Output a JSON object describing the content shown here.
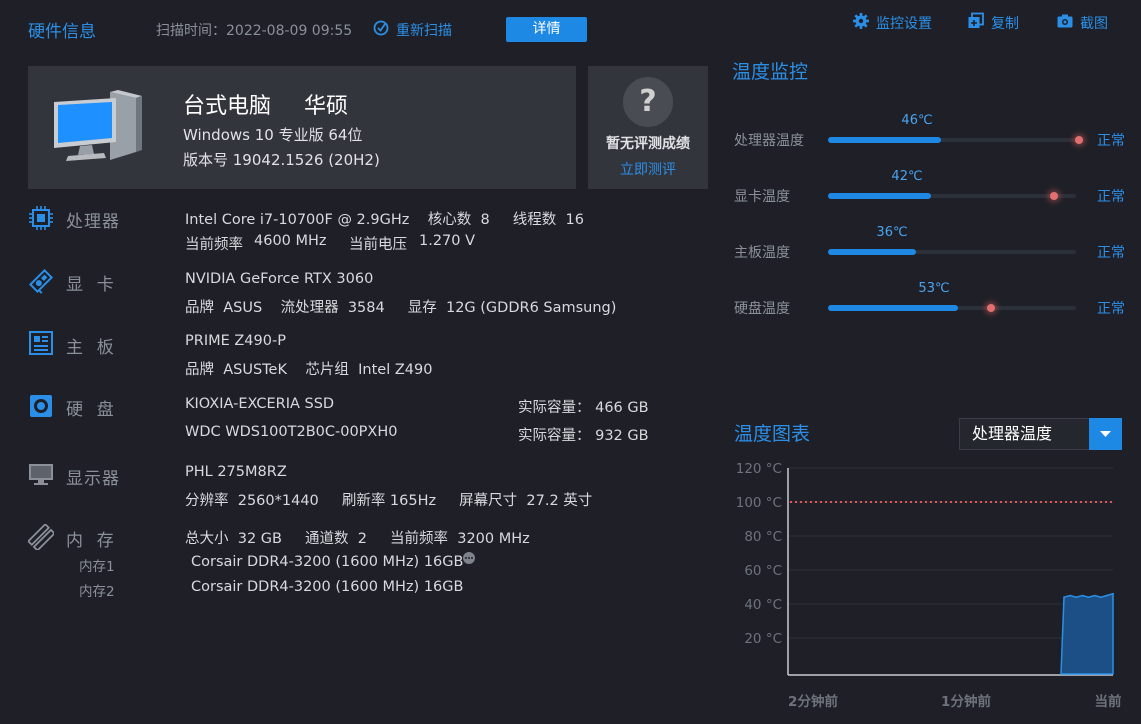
{
  "header": {
    "title": "硬件信息",
    "scan_time": "扫描时间：2022-08-09 09:55",
    "rescan": "重新扫描",
    "detail": "详情",
    "tools": [
      {
        "label": "监控设置",
        "icon": "gear-icon"
      },
      {
        "label": "复制",
        "icon": "copy-icon"
      },
      {
        "label": "截图",
        "icon": "camera-icon"
      }
    ]
  },
  "summary": {
    "type": "台式电脑",
    "brand": "华硕",
    "os": "Windows 10 专业版 64位",
    "version": "版本号  19042.1526 (20H2)"
  },
  "score": {
    "qmark": "?",
    "title": "暂无评测成绩",
    "link": "立即测评"
  },
  "hardware": {
    "cpu": {
      "label": "处理器",
      "line1": "Intel Core i7-10700F @ 2.9GHz    核心数  8     线程数  16",
      "freq_label": "当前频率",
      "freq_value": "4600 MHz",
      "volt_label": "当前电压",
      "volt_value": "1.270 V"
    },
    "gpu": {
      "label": "显  卡",
      "line1": "NVIDIA GeForce RTX 3060",
      "line2": "品牌  ASUS    流处理器  3584     显存  12G (GDDR6 Samsung)"
    },
    "board": {
      "label": "主  板",
      "line1": "PRIME Z490-P",
      "line2": "品牌  ASUSTeK    芯片组  Intel Z490"
    },
    "disk": {
      "label": "硬  盘",
      "items": [
        {
          "name": "KIOXIA-EXCERIA SSD",
          "cap": "实际容量：  466 GB"
        },
        {
          "name": "WDC WDS100T2B0C-00PXH0",
          "cap": "实际容量：  932 GB"
        }
      ]
    },
    "monitor": {
      "label": "显示器",
      "line1": "PHL 275M8RZ",
      "line2": "分辨率  2560*1440     刷新率 165Hz     屏幕尺寸  27.2 英寸"
    },
    "memory": {
      "label": "内  存",
      "line1": "总大小  32 GB     通道数  2     当前频率  3200 MHz",
      "slots": [
        {
          "label": "内存1",
          "value": "Corsair DDR4-3200 (1600 MHz) 16GB"
        },
        {
          "label": "内存2",
          "value": "Corsair DDR4-3200 (1600 MHz) 16GB"
        }
      ]
    }
  },
  "temp_monitor": {
    "title": "温度监控",
    "items": [
      {
        "label": "处理器温度",
        "value": "46℃",
        "status": "正常",
        "level": 0.46
      },
      {
        "label": "显卡温度",
        "value": "42℃",
        "status": "正常",
        "level": 0.42
      },
      {
        "label": "主板温度",
        "value": "36℃",
        "status": "正常",
        "level": 0.36
      },
      {
        "label": "硬盘温度",
        "value": "53℃",
        "status": "正常",
        "level": 0.53
      }
    ]
  },
  "temp_chart": {
    "title": "温度图表",
    "select_value": "处理器温度"
  },
  "chart_data": {
    "type": "area",
    "title": "",
    "xlabel": "",
    "ylabel": "",
    "ylim": [
      10,
      120
    ],
    "y_ticks": [
      "120 °C",
      "100 °C",
      "80 °C",
      "60 °C",
      "40 °C",
      "20 °C"
    ],
    "x_ticks": [
      "2分钟前",
      "1分钟前",
      "当前"
    ],
    "threshold": 100,
    "series": [
      {
        "values": [
          44,
          45,
          44,
          45,
          44,
          45,
          44,
          45,
          46
        ]
      }
    ],
    "colors": {
      "fill": "#1c4f86",
      "line": "#2b8fe8",
      "threshold": "#e05555"
    }
  }
}
